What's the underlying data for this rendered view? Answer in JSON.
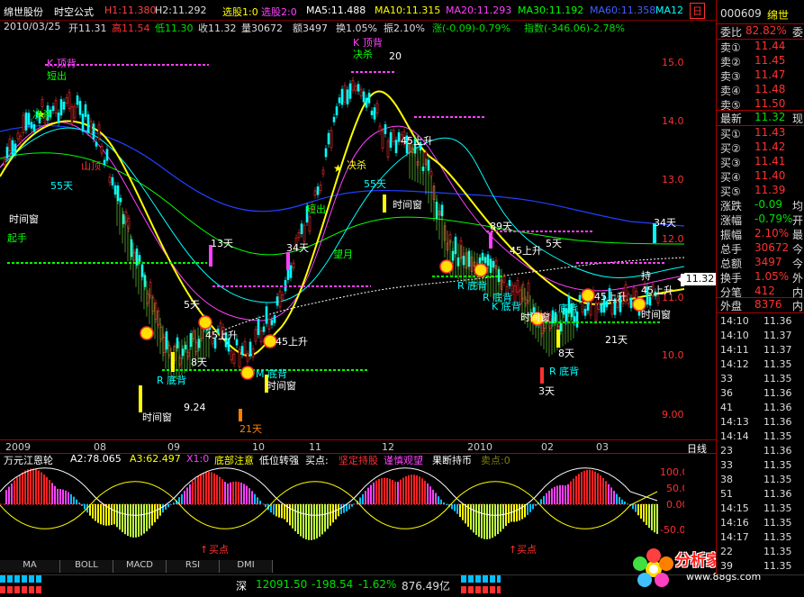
{
  "topbar": {
    "stock_name": "绵世股份",
    "formula": "时空公式",
    "h1": "H1:11.380",
    "h2": "H2:11.292",
    "xuangu": "选股1:0",
    "xuangu2": "选股2:0",
    "ma5": "MA5:11.488",
    "ma10": "MA10:11.315",
    "ma20": "MA20:11.293",
    "ma30": "MA30:11.192",
    "ma60": "MA60:11.358",
    "ma120": "MA12",
    "period_box": "日"
  },
  "infobar": {
    "date": "2010/03/25",
    "open": "开11.31",
    "high": "高11.54",
    "low": "低11.30",
    "close": "收11.32",
    "volume": "量30672",
    "amount": "额3497",
    "turnover": "换1.05%",
    "amplitude": "振2.10%",
    "change": "涨(-0.09)-0.79%",
    "index": "指数(-346.06)-2.78%"
  },
  "price_axis": [
    "15.00",
    "14.00",
    "13.00",
    "12.00",
    "11.00",
    "10.00",
    "9.00"
  ],
  "current_price_tag": "11.32",
  "annotations": {
    "k_top": "K 顶背",
    "k_top2": "K 顶背",
    "jue_sha1": "决杀",
    "jue_sha2": "决杀",
    "jue_sha3": "决杀",
    "short_out": "短出",
    "short_out2": "短出",
    "d55": "55天",
    "d55b": "55天",
    "d89": "89天",
    "d34": "34天",
    "d34b": "34天",
    "d13": "13天",
    "d8": "8天",
    "d8b": "8天",
    "d5": "5天",
    "d5b": "5天",
    "d21": "21天",
    "d21b": "21天",
    "d3": "3天",
    "window1": "时间窗",
    "window2": "时间窗",
    "window3": "时间窗",
    "window4": "时间窗",
    "window5": "时间窗",
    "window6": "时间窗",
    "bottom1": "R 底背",
    "bottom2": "M 底背",
    "bottom3": "R 底背",
    "bottom4": "R 底背",
    "bottom5": "K 底背",
    "bottom6": "R 底背",
    "bottom7": "底背",
    "up45a": "45上升",
    "up45b": "45上升",
    "up45c": "45上升",
    "up45d": "45上升",
    "up45e": "45上升",
    "up45f": "45上升",
    "wang_yue": "望月",
    "chi_zhi": "持",
    "shan_hu": "山顶",
    "low_924": "9.24",
    "v2020": "20",
    "qi_shou": "起手"
  },
  "xaxis": {
    "labels": [
      "2009",
      "08",
      "09",
      "10",
      "11",
      "12",
      "2010",
      "02",
      "03"
    ],
    "period": "日线"
  },
  "indicator_header": {
    "name": "万元江恩轮",
    "a2": "A2:78.065",
    "a3": "A3:62.497",
    "x1": "X1:0",
    "bottom_attention": "底部注意",
    "low_turn": "低位转强",
    "buy_point": "买点:",
    "firm_hold": "坚定持股",
    "cautious": "谨慎观望",
    "sell_stock": "果断持币",
    "sell_point": "卖点:0"
  },
  "ind_axis": [
    "100.00",
    "50.00",
    "0.00",
    "-50.00"
  ],
  "ind_buy_labels": [
    "买点",
    "买点"
  ],
  "tabs": [
    "MA",
    "BOLL",
    "MACD",
    "RSI",
    "DMI"
  ],
  "status": {
    "market": "深",
    "index": "12091.50",
    "change": "-198.54",
    "pct": "-1.62%",
    "amount": "876.49亿",
    "brand": "分析家公式网",
    "brand_url": "www.88gs.com"
  },
  "quote": {
    "code": "000609",
    "name": "绵世",
    "weibi_label": "委比",
    "weibi_value": "82.82%",
    "weibi_tail": "委",
    "sells": [
      {
        "label": "卖⑤",
        "price": "11.50"
      },
      {
        "label": "卖④",
        "price": "11.48"
      },
      {
        "label": "卖③",
        "price": "11.47"
      },
      {
        "label": "卖②",
        "price": "11.45"
      },
      {
        "label": "卖①",
        "price": "11.44"
      }
    ],
    "latest_label": "最新",
    "latest_value": "11.32",
    "latest_tail": "现",
    "buys": [
      {
        "label": "买①",
        "price": "11.43"
      },
      {
        "label": "买②",
        "price": "11.42"
      },
      {
        "label": "买③",
        "price": "11.41"
      },
      {
        "label": "买④",
        "price": "11.40"
      },
      {
        "label": "买⑤",
        "price": "11.39"
      }
    ],
    "stats": [
      {
        "label": "涨跌",
        "value": "-0.09",
        "tail": "均"
      },
      {
        "label": "涨幅",
        "value": "-0.79%",
        "tail": "开"
      },
      {
        "label": "振幅",
        "value": "2.10%",
        "tail": "最"
      },
      {
        "label": "总手",
        "value": "30672",
        "tail": "今"
      },
      {
        "label": "总额",
        "value": "3497",
        "tail": "今"
      },
      {
        "label": "换手",
        "value": "1.05%",
        "tail": "外"
      },
      {
        "label": "分笔",
        "value": "412",
        "tail": "内"
      }
    ],
    "outer_label": "外盘",
    "outer_value": "8376",
    "outer_tail": "内",
    "ticks": [
      {
        "time": "14:10",
        "price": "11.36"
      },
      {
        "time": "14:10",
        "price": "11.37"
      },
      {
        "time": "14:11",
        "price": "11.37"
      },
      {
        "time": "14:12",
        "price": "11.35"
      },
      {
        "time": "33",
        "price": "11.35"
      },
      {
        "time": "36",
        "price": "11.36"
      },
      {
        "time": "41",
        "price": "11.36"
      },
      {
        "time": "14:13",
        "price": "11.36"
      },
      {
        "time": "14:14",
        "price": "11.35"
      },
      {
        "time": "23",
        "price": "11.36"
      },
      {
        "time": "33",
        "price": "11.35"
      },
      {
        "time": "38",
        "price": "11.35"
      },
      {
        "time": "51",
        "price": "11.36"
      },
      {
        "time": "14:15",
        "price": "11.35"
      },
      {
        "time": "14:16",
        "price": "11.35"
      },
      {
        "time": "14:17",
        "price": "11.35"
      },
      {
        "time": "22",
        "price": "11.35"
      },
      {
        "time": "39",
        "price": "11.35"
      }
    ]
  },
  "colors": {
    "up": "#ff3030",
    "down": "#00ffff",
    "ma_yellow": "#ffff00",
    "ma_green": "#00ff00",
    "ma_blue": "#2040ff",
    "ma_white": "#ffffff",
    "magenta": "#ff40ff"
  }
}
